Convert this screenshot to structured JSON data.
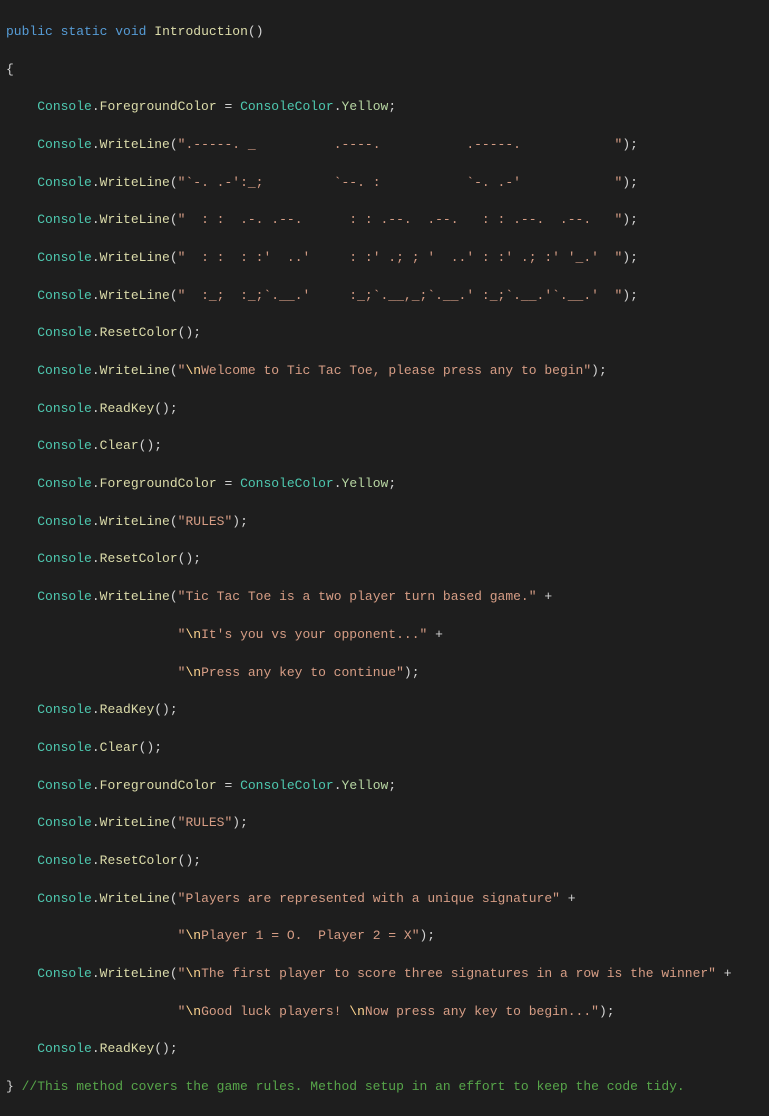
{
  "code": {
    "line1_public": "public",
    "line1_static": "static",
    "line1_void": "void",
    "line1_method": "Introduction",
    "line2_brace": "{",
    "fg_assign_console": "Console",
    "fg_assign_prop": "ForegroundColor",
    "fg_assign_eq": " = ",
    "fg_assign_class": "ConsoleColor",
    "fg_assign_val": "Yellow",
    "console": "Console",
    "writeline": "WriteLine",
    "resetcolor": "ResetColor",
    "readkey": "ReadKey",
    "clear": "Clear",
    "ascii1": "\".-----. _          .----.           .-----.            \"",
    "ascii2": "\"`-. .-':_;         `--. :           `-. .-'            \"",
    "ascii3": "\"  : :  .-. .--.      : : .--.  .--.   : : .--.  .--.   \"",
    "ascii4": "\"  : :  : :'  ..'     : :' .; ; '  ..' : :' .; :' '_.'  \"",
    "ascii5": "\"  :_;  :_;`.__.'     :_;`.__,_;`.__.' :_;`.__.'`.__.'  \"",
    "welcome_esc": "\\n",
    "welcome_str_pre": "\"",
    "welcome_str_post": "Welcome to Tic Tac Toe, please press any to begin\"",
    "rules_str": "\"RULES\"",
    "tictac_str": "\"Tic Tac Toe is a two player turn based game.\"",
    "its_you_pre": "\"",
    "its_you_esc": "\\n",
    "its_you_post": "It's you vs your opponent...\"",
    "press_any_pre": "\"",
    "press_any_esc": "\\n",
    "press_any_post": "Press any key to continue\"",
    "players_str": "\"Players are represented with a unique signature\"",
    "player12_pre": "\"",
    "player12_esc": "\\n",
    "player12_post": "Player 1 = O.  Player 2 = X\"",
    "first_player_pre": "\"",
    "first_player_esc": "\\n",
    "first_player_post": "The first player to score three signatures in a row is the winner\"",
    "goodluck_pre": "\"",
    "goodluck_esc1": "\\n",
    "goodluck_mid": "Good luck players! ",
    "goodluck_esc2": "\\n",
    "goodluck_post": "Now press any key to begin...\"",
    "end_brace": "}",
    "comment": "//This method covers the game rules. Method setup in an effort to keep the code tidy.",
    "plus": " +"
  }
}
